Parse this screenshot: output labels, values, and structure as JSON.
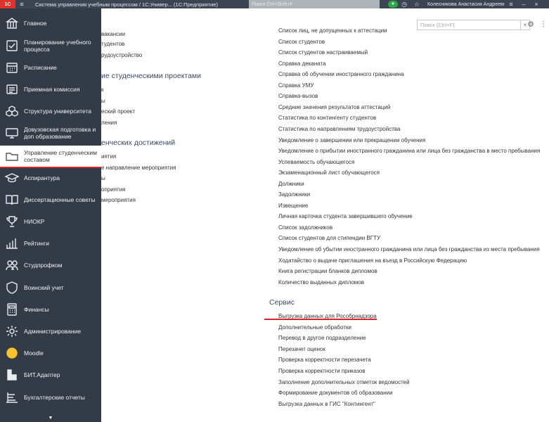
{
  "topbar": {
    "logo": "1С",
    "title": "Система управления учебным процессом / 1С:Универ...   (1С:Предприятие)",
    "search_placeholder": "Поиск Ctrl+Shift+F",
    "user": "Колесникова Анастасия Андреевна",
    "icons": [
      "menu-icon",
      "notification-icon",
      "history-icon",
      "star-icon",
      "settings-icon",
      "minimize-icon",
      "close-icon"
    ]
  },
  "sidebar": {
    "items": [
      {
        "label": "Главное",
        "icon": "building-icon"
      },
      {
        "label": "Планирование учебного процесса",
        "icon": "checklist-icon"
      },
      {
        "label": "Расписание",
        "icon": "calendar-icon"
      },
      {
        "label": "Приемная комиссия",
        "icon": "list-icon"
      },
      {
        "label": "Структура университета",
        "icon": "cubes-icon"
      },
      {
        "label": "Довузовская подготовка и доп образование",
        "icon": "monitor-icon"
      },
      {
        "label": "Управление студенческим составом",
        "icon": "folder-icon"
      },
      {
        "label": "Аспирантура",
        "icon": "graduation-cap-icon"
      },
      {
        "label": "Диссертационные советы",
        "icon": "book-icon"
      },
      {
        "label": "НИОКР",
        "icon": "trophy-icon"
      },
      {
        "label": "Рейтинги",
        "icon": "bar-chart-icon"
      },
      {
        "label": "Студпрофком",
        "icon": "people-icon"
      },
      {
        "label": "Воинский учет",
        "icon": "shield-icon"
      },
      {
        "label": "Финансы",
        "icon": "calculator-icon"
      },
      {
        "label": "Администрирование",
        "icon": "gear-icon"
      },
      {
        "label": "Moodle",
        "icon": "moodle-icon"
      },
      {
        "label": "БИТ.Адаптер",
        "icon": "bit-adapter-icon"
      },
      {
        "label": "Бухгалтерские отчеты",
        "icon": "report-icon"
      }
    ],
    "active_index": 6
  },
  "main": {
    "search_placeholder": "Поиск (Ctrl+F)",
    "left_column": [
      {
        "type": "item",
        "text": "вакансии"
      },
      {
        "type": "item",
        "text": "тудентов"
      },
      {
        "type": "item",
        "text": "рудоустройство"
      },
      {
        "type": "head",
        "text": "ие студенческими проектами"
      },
      {
        "type": "item",
        "text": "к"
      },
      {
        "type": "item",
        "text": "ы"
      },
      {
        "type": "item",
        "text": "еский проект"
      },
      {
        "type": "item",
        "text": "ления"
      },
      {
        "type": "head",
        "text": "енческих достижений"
      },
      {
        "type": "item",
        "text": "иятия"
      },
      {
        "type": "item",
        "text": "е направление мероприятия"
      },
      {
        "type": "item",
        "text": "ы"
      },
      {
        "type": "item",
        "text": "оприятия"
      },
      {
        "type": "item",
        "text": "мероприятия"
      }
    ],
    "reports": [
      "Список лиц, не допущенных к аттестации",
      "Список студентов",
      "Список студентов настраиваемый",
      "Справка деканата",
      "Справка об обучении иностранного гражданина",
      "Справка УМУ",
      "Справка-вызов",
      "Средние значения результатов аттестаций",
      "Статистика по контингенту студентов",
      "Статистика по направлениям трудоустройства",
      "Уведомление о завершении или прекращении обучения",
      "Уведомление о прибытии иностранного гражданина или лица без гражданства в место пребывания",
      "Успеваемость обучающегося",
      "Экзаменационный лист обучающегося",
      "Должники",
      "Задолжники",
      "Извещение",
      "Личная карточка студента завершившего обучение",
      "Список задолжников",
      "Список студентов для стипендии ВГТУ",
      "Уведомление об убытии иностранного гражданина или лица без гражданства из места пребывания",
      "Ходатайство о выдаче приглашения на въезд в Российскую Федерацию",
      "Книга регистрации бланков дипломов",
      "Количество выданных дипломов"
    ],
    "service_title": "Сервис",
    "service": [
      "Выгрузка данных для Рособрнадзора",
      "Дополнительные обработки",
      "Перевод в другое подразделение",
      "Перезачет оценок",
      "Проверка корректности перезачета",
      "Проверка корректности приказов",
      "Заполнение дополнительных отметок ведомостей",
      "Формирование документов об образовании",
      "Выгрузка данных в ГИС \"Контингент\""
    ]
  }
}
